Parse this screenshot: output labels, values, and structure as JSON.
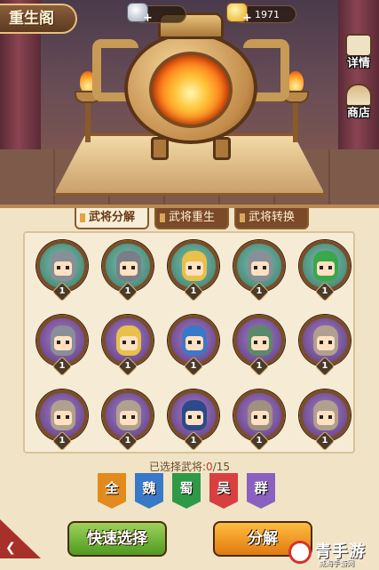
{
  "header": {
    "title": "重生阁"
  },
  "currency": {
    "silver": {
      "icon": "silver-ingot-icon",
      "plus": "+",
      "value": ""
    },
    "gold": {
      "icon": "gold-ingot-icon",
      "plus": "+",
      "value": "1971"
    }
  },
  "side_buttons": {
    "details": {
      "icon": "scroll-icon",
      "label": "详情"
    },
    "shop": {
      "icon": "shop-icon",
      "label": "商店"
    }
  },
  "tabs": [
    {
      "label": "武将分解",
      "active": true
    },
    {
      "label": "武将重生",
      "active": false
    },
    {
      "label": "武将转换",
      "active": false
    }
  ],
  "heroes": [
    {
      "level": "1",
      "ring": "green",
      "helmet": "#8a8e98"
    },
    {
      "level": "1",
      "ring": "green",
      "helmet": "#7a7e88"
    },
    {
      "level": "1",
      "ring": "green",
      "helmet": "#e8c04a"
    },
    {
      "level": "1",
      "ring": "green",
      "helmet": "#8a8e98"
    },
    {
      "level": "1",
      "ring": "green",
      "helmet": "#3aa84a"
    },
    {
      "level": "1",
      "ring": "purple",
      "helmet": "#8a8e98"
    },
    {
      "level": "1",
      "ring": "purple",
      "helmet": "#e8c04a"
    },
    {
      "level": "1",
      "ring": "purple",
      "helmet": "#3a78c8"
    },
    {
      "level": "1",
      "ring": "purple",
      "helmet": "#5a8a6a"
    },
    {
      "level": "1",
      "ring": "purple",
      "helmet": "#b0a090"
    },
    {
      "level": "1",
      "ring": "purple",
      "helmet": "#b0a090"
    },
    {
      "level": "1",
      "ring": "purple",
      "helmet": "#b0a090"
    },
    {
      "level": "1",
      "ring": "purple",
      "helmet": "#2a4a8a"
    },
    {
      "level": "1",
      "ring": "purple",
      "helmet": "#a09080"
    },
    {
      "level": "1",
      "ring": "purple",
      "helmet": "#b0a090"
    }
  ],
  "selection": {
    "prefix": "已选择武将:",
    "count": "0",
    "total": "/15"
  },
  "factions": [
    {
      "label": "全",
      "key": "all"
    },
    {
      "label": "魏",
      "key": "wei"
    },
    {
      "label": "蜀",
      "key": "shu"
    },
    {
      "label": "吴",
      "key": "wu"
    },
    {
      "label": "群",
      "key": "qun"
    }
  ],
  "buttons": {
    "back_icon": "back-arrow-icon",
    "quick_select": "快速选择",
    "decompose": "分解"
  },
  "watermark": {
    "big": "青手游",
    "small": "威海手游网"
  },
  "colors": {
    "panel_bg": "#f1e4c6",
    "quick_btn": "#6bb82a",
    "decompose_btn": "#f0a020",
    "count_highlight": "#c0392b"
  }
}
